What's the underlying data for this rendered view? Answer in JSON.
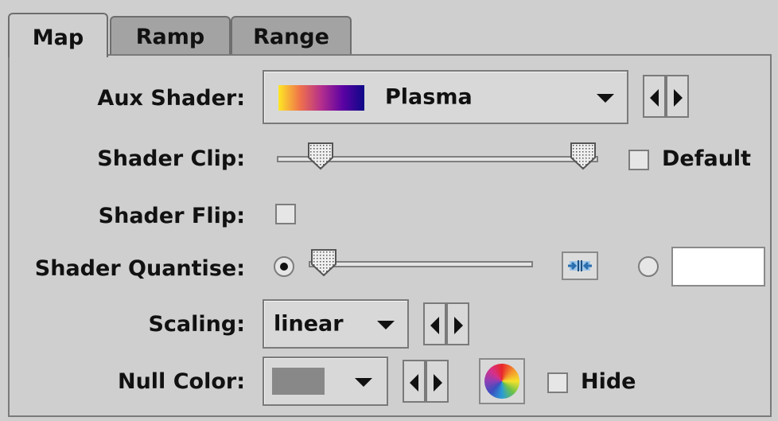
{
  "tabs": [
    {
      "label": "Map",
      "active": true
    },
    {
      "label": "Ramp",
      "active": false
    },
    {
      "label": "Range",
      "active": false
    }
  ],
  "rows": {
    "aux_shader": {
      "label": "Aux Shader:",
      "value": "Plasma",
      "gradient": [
        "#fde725",
        "#f0734a",
        "#b42e8d",
        "#5b02a3",
        "#0d0887"
      ]
    },
    "shader_clip": {
      "label": "Shader Clip:",
      "low": 0.1,
      "high": 0.98,
      "default_label": "Default",
      "default_checked": false
    },
    "shader_flip": {
      "label": "Shader Flip:",
      "checked": false
    },
    "shader_quantise": {
      "label": "Shader Quantise:",
      "slider_selected": true,
      "slider_value": 0.0,
      "text_value": ""
    },
    "scaling": {
      "label": "Scaling:",
      "value": "linear"
    },
    "null_color": {
      "label": "Null Color:",
      "color": "#888888",
      "hide_label": "Hide",
      "hide_checked": false
    }
  },
  "colors": {
    "accent_icon": "#2a6fb0"
  }
}
